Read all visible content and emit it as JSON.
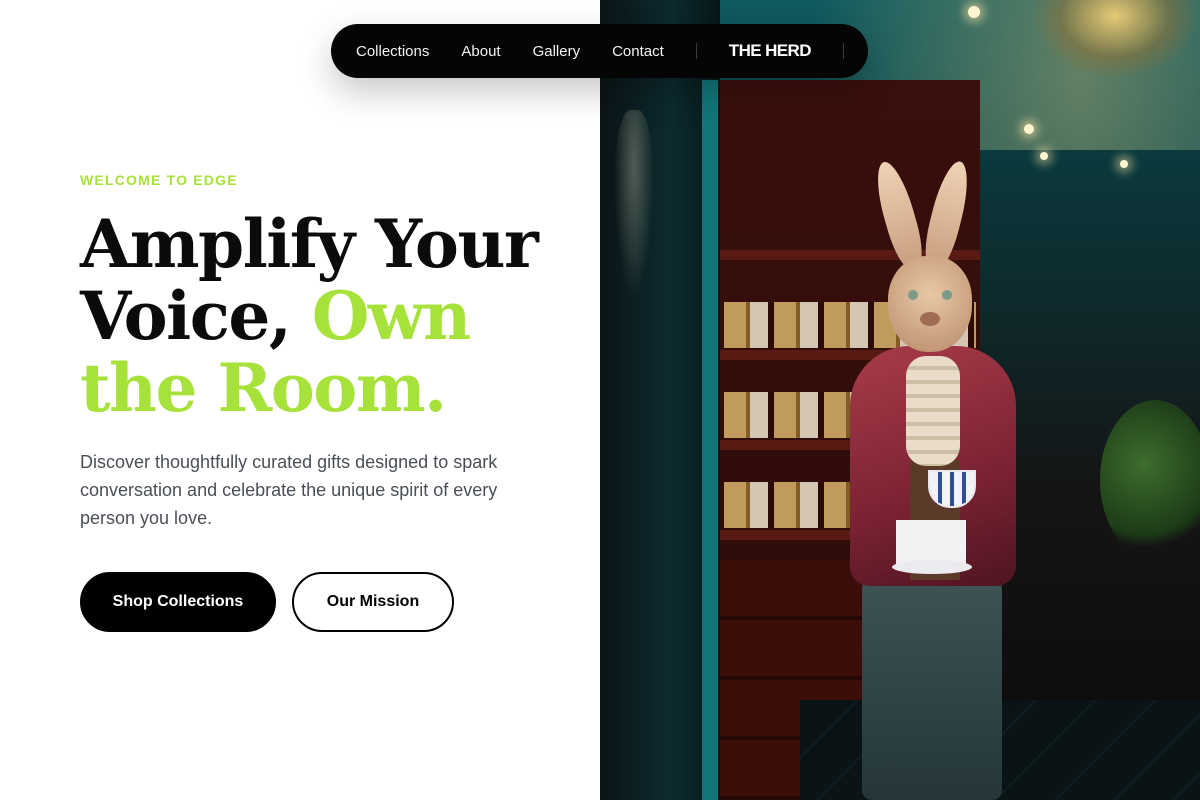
{
  "nav": {
    "links": [
      "Collections",
      "About",
      "Gallery",
      "Contact"
    ],
    "brand": "THE HERD"
  },
  "hero": {
    "eyebrow": "WELCOME TO EDGE",
    "headline_part1": "Amplify Your Voice, ",
    "headline_accent": "Own the Room.",
    "description": "Discover thoughtfully curated gifts designed to spark conversation and celebrate the unique spirit of every person you love.",
    "primary_cta": "Shop Collections",
    "secondary_cta": "Our Mission",
    "image_description": "Costumed rabbit figure in a red coat holding a teacup inside a teal shop with wooden shelving"
  },
  "colors": {
    "accent": "#a6e23a",
    "nav_background": "#050505",
    "text_dark": "#0b0b0b",
    "text_muted": "#4a4f57"
  }
}
